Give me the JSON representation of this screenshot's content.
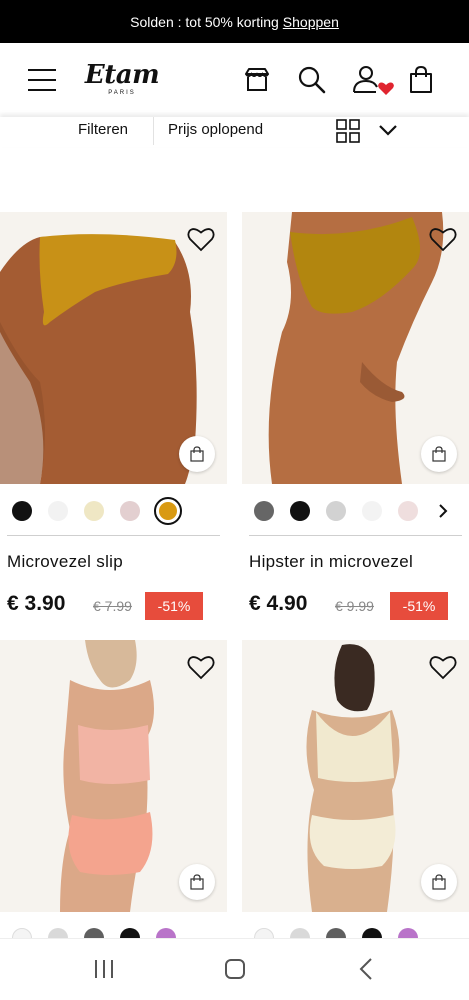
{
  "promo": {
    "text": "Solden : tot 50% korting",
    "link": "Shoppen"
  },
  "header": {
    "brand": "Etam",
    "brand_sub": "PARIS"
  },
  "filters": {
    "filter_label": "Filteren",
    "sort_label": "Prijs oplopend"
  },
  "products": [
    {
      "name": "Microvezel slip",
      "price": "€ 3.90",
      "old_price": "€ 7.99",
      "discount": "-51%",
      "swatches": [
        "#111111",
        "#f2f2f2",
        "#efe7c4",
        "#e3cfd0",
        "#d99a12"
      ],
      "selected_swatch": 4
    },
    {
      "name": "Hipster in microvezel",
      "price": "€ 4.90",
      "old_price": "€ 9.99",
      "discount": "-51%",
      "swatches": [
        "#666666",
        "#111111",
        "#d2d2d2",
        "#f3f3f3",
        "#efdede"
      ]
    },
    {
      "swatches": [
        "#f4f4f4",
        "#d9d9d9",
        "#5f5f5f",
        "#111111",
        "#b974c9"
      ]
    },
    {
      "swatches": [
        "#f4f4f4",
        "#d9d9d9",
        "#5f5f5f",
        "#111111",
        "#b974c9"
      ]
    }
  ],
  "colors": {
    "accent_red": "#e74c3c",
    "heart_red": "#e0242f"
  }
}
